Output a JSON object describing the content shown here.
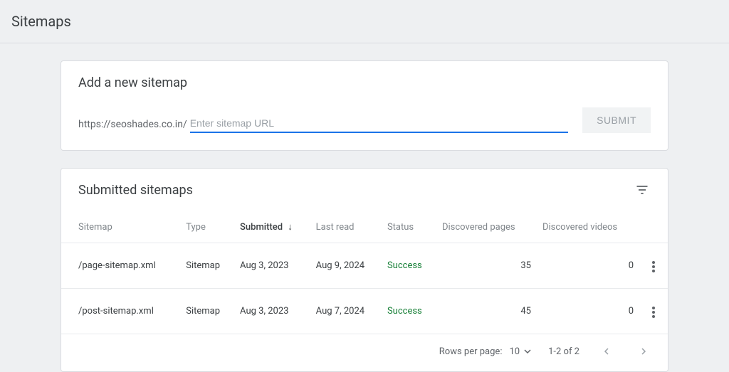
{
  "page_title": "Sitemaps",
  "add_card": {
    "title": "Add a new sitemap",
    "url_prefix": "https://seoshades.co.in/",
    "placeholder": "Enter sitemap URL",
    "submit_label": "SUBMIT"
  },
  "list_card": {
    "title": "Submitted sitemaps",
    "columns": {
      "sitemap": "Sitemap",
      "type": "Type",
      "submitted": "Submitted",
      "last_read": "Last read",
      "status": "Status",
      "discovered_pages": "Discovered pages",
      "discovered_videos": "Discovered videos"
    },
    "sort_indicator": "↓",
    "rows": [
      {
        "sitemap": "/page-sitemap.xml",
        "type": "Sitemap",
        "submitted": "Aug 3, 2023",
        "last_read": "Aug 9, 2024",
        "status": "Success",
        "discovered_pages": "35",
        "discovered_videos": "0"
      },
      {
        "sitemap": "/post-sitemap.xml",
        "type": "Sitemap",
        "submitted": "Aug 3, 2023",
        "last_read": "Aug 7, 2024",
        "status": "Success",
        "discovered_pages": "45",
        "discovered_videos": "0"
      }
    ],
    "pager": {
      "rows_per_page_label": "Rows per page:",
      "rows_per_page_value": "10",
      "range_label": "1-2 of 2"
    }
  }
}
